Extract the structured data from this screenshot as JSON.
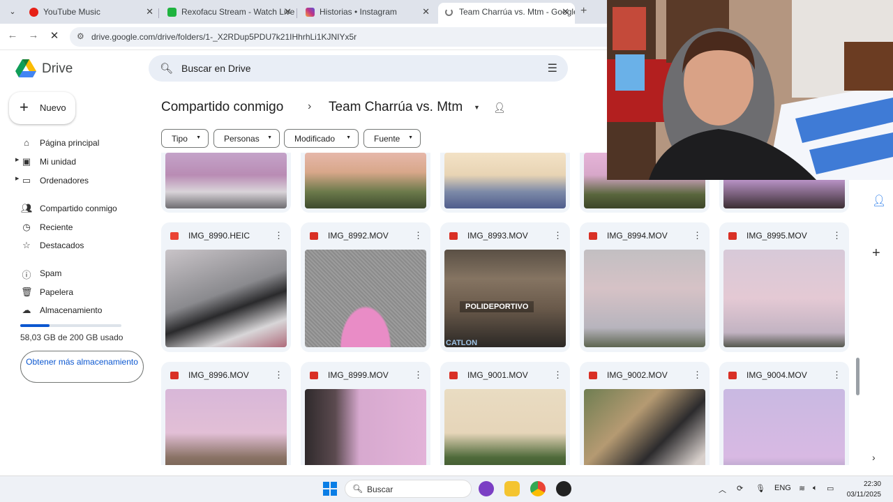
{
  "browser": {
    "tabs": [
      {
        "title": "YouTube Music",
        "favicon_color": "#e62117"
      },
      {
        "title": "Rexofacu Stream - Watch Live o",
        "favicon_color": "#1fb33f"
      },
      {
        "title": "Historias • Instagram",
        "favicon_color": "#c13584"
      },
      {
        "title": "Team Charrúa vs. Mtm - Google",
        "favicon_color": "#7a7a7a"
      }
    ],
    "url": "drive.google.com/drive/folders/1-_X2RDup5PDU7k21IHhrhLi1KJNIYx5r"
  },
  "drive": {
    "app_name": "Drive",
    "search_placeholder": "Buscar en Drive",
    "new_label": "Nuevo",
    "nav": [
      {
        "label": "Página principal",
        "icon": "home-icon"
      },
      {
        "label": "Mi unidad",
        "icon": "drive-icon"
      },
      {
        "label": "Ordenadores",
        "icon": "computer-icon"
      },
      {
        "label": "Compartido conmigo",
        "icon": "people-icon"
      },
      {
        "label": "Reciente",
        "icon": "clock-icon"
      },
      {
        "label": "Destacados",
        "icon": "star-icon"
      },
      {
        "label": "Spam",
        "icon": "spam-icon"
      },
      {
        "label": "Papelera",
        "icon": "trash-icon"
      },
      {
        "label": "Almacenamiento",
        "icon": "cloud-icon"
      }
    ],
    "storage_used_fraction": 0.29,
    "storage_text": "58,03 GB de 200 GB usado",
    "more_storage_label": "Obtener más almacenamiento",
    "breadcrumb_parent": "Compartido conmigo",
    "breadcrumb_current": "Team Charrúa vs. Mtm",
    "filters": [
      "Tipo",
      "Personas",
      "Modificado",
      "Fuente"
    ],
    "files": [
      {
        "name": "IMG_8990.HEIC",
        "type": "image"
      },
      {
        "name": "IMG_8992.MOV",
        "type": "video"
      },
      {
        "name": "IMG_8993.MOV",
        "type": "video"
      },
      {
        "name": "IMG_8994.MOV",
        "type": "video"
      },
      {
        "name": "IMG_8995.MOV",
        "type": "video"
      },
      {
        "name": "IMG_8996.MOV",
        "type": "video"
      },
      {
        "name": "IMG_8999.MOV",
        "type": "video"
      },
      {
        "name": "IMG_9001.MOV",
        "type": "video"
      },
      {
        "name": "IMG_9002.MOV",
        "type": "video"
      },
      {
        "name": "IMG_9004.MOV",
        "type": "video"
      }
    ],
    "thumb_texts": {
      "polideportivo": "POLIDEPORTIVO",
      "cat": "CATLON"
    },
    "colors": {
      "accent": "#0b57d0",
      "image_icon": "#ea4335",
      "video_icon": "#d93025",
      "card_bg": "#f0f4f9"
    }
  },
  "taskbar": {
    "search_label": "Buscar",
    "language": "ENG",
    "time": "22:30",
    "date": "03/11/2025"
  }
}
